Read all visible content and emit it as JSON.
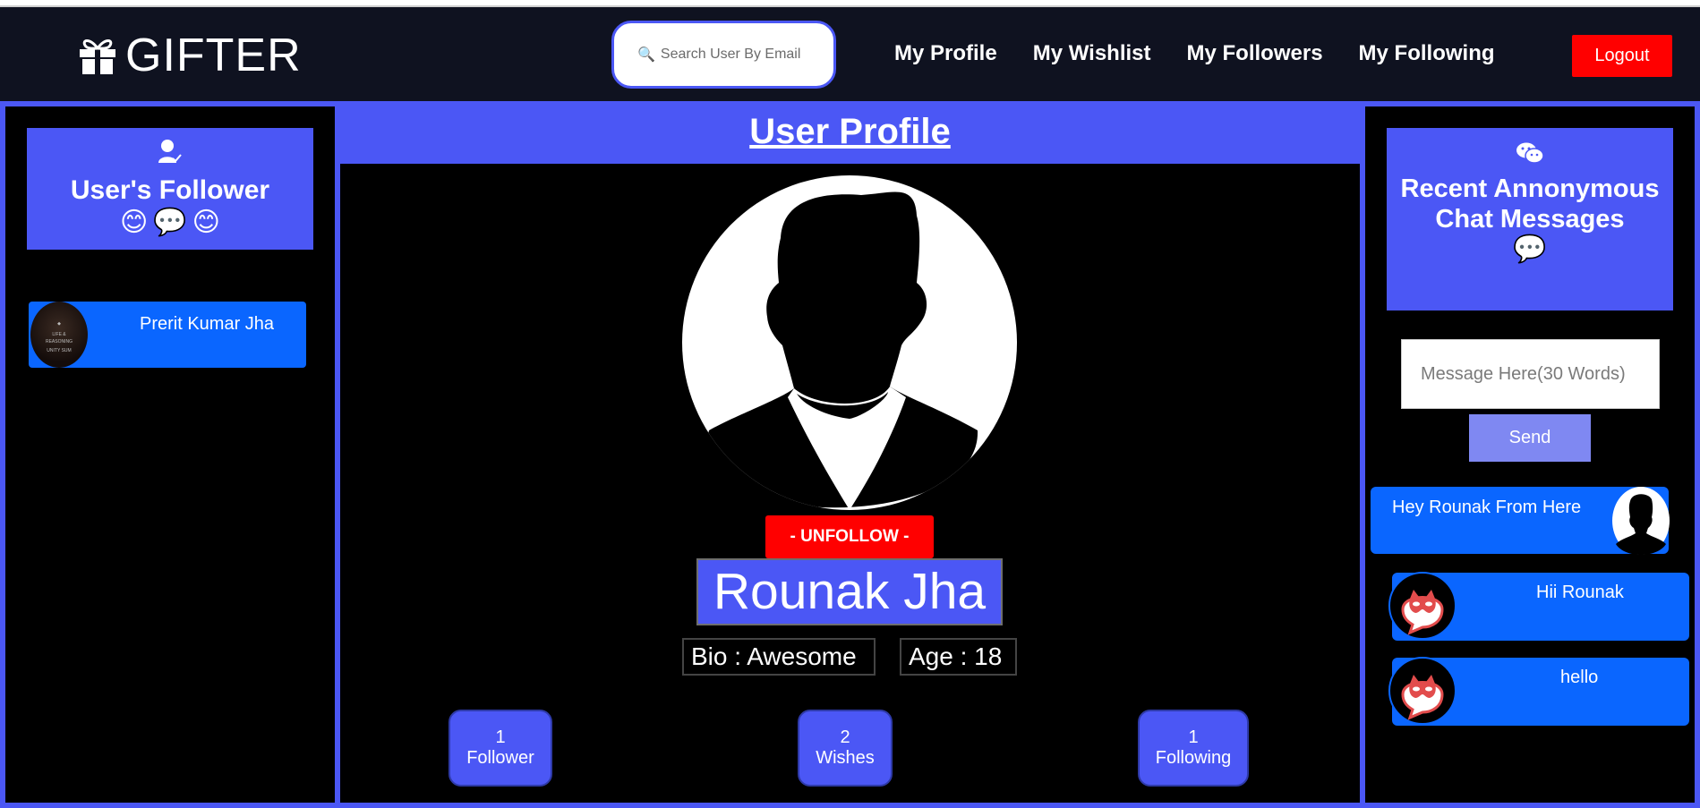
{
  "brand": {
    "name": "GIFTER"
  },
  "search": {
    "placeholder": "Search User By Email"
  },
  "nav": {
    "items": [
      "My Profile",
      "My Wishlist",
      "My Followers",
      "My Following"
    ],
    "logout": "Logout"
  },
  "left_panel": {
    "title": "User's Follower",
    "followers": [
      {
        "name": "Prerit Kumar Jha"
      }
    ]
  },
  "center": {
    "title": "User Profile",
    "unfollow_label": "- UNFOLLOW -",
    "user_name": "Rounak Jha",
    "bio": "Bio : Awesome",
    "age": "Age : 18",
    "stats": [
      {
        "value": "1",
        "label": "Follower"
      },
      {
        "value": "2",
        "label": "Wishes"
      },
      {
        "value": "1",
        "label": "Following"
      }
    ]
  },
  "right_panel": {
    "title": "Recent Annonymous Chat Messages",
    "message_placeholder": "Message Here(30 Words)",
    "send_label": "Send",
    "messages": [
      {
        "text": "Hey Rounak From Here"
      },
      {
        "text": "Hii Rounak"
      },
      {
        "text": "hello"
      }
    ]
  },
  "colors": {
    "accent": "#4b57f5",
    "navbar": "#0f1220",
    "danger": "#ff0000",
    "chat_bubble": "#0a66ff"
  }
}
